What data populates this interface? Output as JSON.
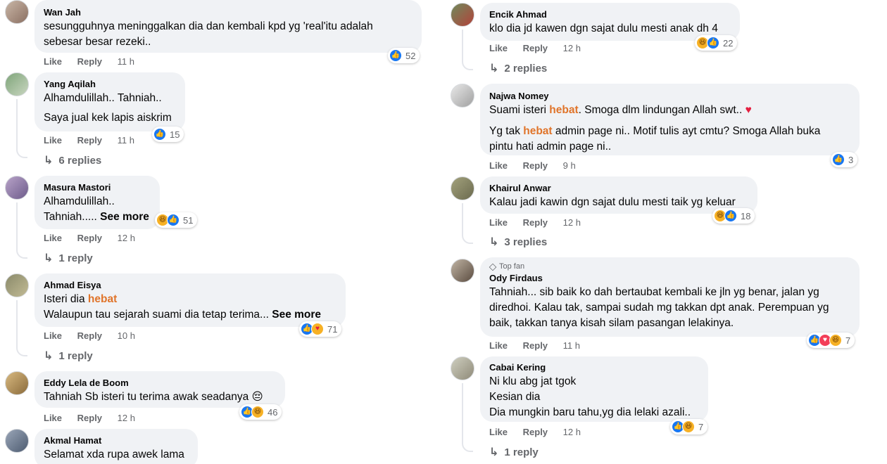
{
  "left_column": [
    {
      "author": "Wan Jah",
      "lines": [
        "sesungguhnya meninggalkan dia dan kembali kpd yg 'real'itu adalah",
        "sebesar besar rezeki.."
      ],
      "like": "Like",
      "reply": "Reply",
      "time": "11 h",
      "reactions": [
        "like"
      ],
      "count": "52",
      "replies": ""
    },
    {
      "author": "Yang Aqilah",
      "lines": [
        "Alhamdulillah.. Tahniah..",
        "Saya jual kek lapis aiskrim"
      ],
      "like": "Like",
      "reply": "Reply",
      "time": "11 h",
      "reactions": [
        "like"
      ],
      "count": "15",
      "replies": "6 replies"
    },
    {
      "author": "Masura Mastori",
      "lines": [
        "Alhamdulillah..",
        "Tahniah....."
      ],
      "see_more": "See more",
      "like": "Like",
      "reply": "Reply",
      "time": "12 h",
      "reactions": [
        "haha",
        "like"
      ],
      "count": "51",
      "replies": "1 reply"
    },
    {
      "author": "Ahmad Eisya",
      "line1_pre": "Isteri dia ",
      "line1_hl": "hebat",
      "line2": "Walaupun tau sejarah suami dia tetap terima...",
      "see_more": "See more",
      "like": "Like",
      "reply": "Reply",
      "time": "10 h",
      "reactions": [
        "like",
        "care"
      ],
      "count": "71",
      "replies": "1 reply"
    },
    {
      "author": "Eddy Lela de Boom",
      "lines": [
        "Tahniah Sb isteri tu terima awak seadanya"
      ],
      "emoji": "😔",
      "like": "Like",
      "reply": "Reply",
      "time": "12 h",
      "reactions": [
        "like",
        "haha"
      ],
      "count": "46",
      "replies": ""
    },
    {
      "author": "Akmal Hamat",
      "lines": [
        "Selamat xda rupa awek lama"
      ],
      "like": "",
      "reply": "",
      "time": "",
      "reactions": [],
      "count": "",
      "replies": ""
    }
  ],
  "right_column": [
    {
      "author": "Encik Ahmad",
      "lines": [
        "klo dia jd kawen dgn sajat dulu mesti anak dh 4"
      ],
      "like": "Like",
      "reply": "Reply",
      "time": "12 h",
      "reactions": [
        "haha",
        "like"
      ],
      "count": "22",
      "replies": "2 replies"
    },
    {
      "author": "Najwa Nomey",
      "line1_pre": "Suami isteri ",
      "line1_hl": "hebat",
      "line1_post": ". Smoga dlm lindungan Allah swt..",
      "heart": "♥",
      "line2_pre": "Yg tak ",
      "line2_hl": "hebat",
      "line2_post": " admin page ni.. Motif tulis ayt cmtu? Smoga Allah buka",
      "line3": "pintu hati admin page ni..",
      "like": "Like",
      "reply": "Reply",
      "time": "9 h",
      "reactions": [
        "like"
      ],
      "count": "3",
      "replies": ""
    },
    {
      "author": "Khairul Anwar",
      "lines": [
        "Kalau jadi kawin dgn sajat dulu mesti taik yg keluar"
      ],
      "like": "Like",
      "reply": "Reply",
      "time": "12 h",
      "reactions": [
        "haha",
        "like"
      ],
      "count": "18",
      "replies": "3 replies"
    },
    {
      "badge": "Top fan",
      "author": "Ody Firdaus",
      "lines": [
        "Tahniah... sib baik ko dah bertaubat kembali ke jln yg benar, jalan yg",
        "diredhoi. Kalau tak, sampai sudah mg takkan dpt anak. Perempuan yg",
        "baik, takkan tanya kisah silam pasangan lelakinya."
      ],
      "like": "Like",
      "reply": "Reply",
      "time": "11 h",
      "reactions": [
        "like",
        "love",
        "haha"
      ],
      "count": "7",
      "replies": ""
    },
    {
      "author": "Cabai Kering",
      "lines": [
        "Ni klu abg jat tgok",
        "Kesian dia",
        "Dia mungkin baru tahu,yg dia lelaki azali.."
      ],
      "like": "Like",
      "reply": "Reply",
      "time": "12 h",
      "reactions": [
        "like",
        "haha"
      ],
      "count": "7",
      "replies": "1 reply"
    }
  ],
  "colors": {
    "bubble": "#f0f2f5",
    "meta": "#65676b",
    "highlight": "#e0742a",
    "like_blue": "#1877f2"
  },
  "icons": {
    "reply_arrow": "reply-arrow-icon",
    "top_fan": "diamond-icon"
  }
}
